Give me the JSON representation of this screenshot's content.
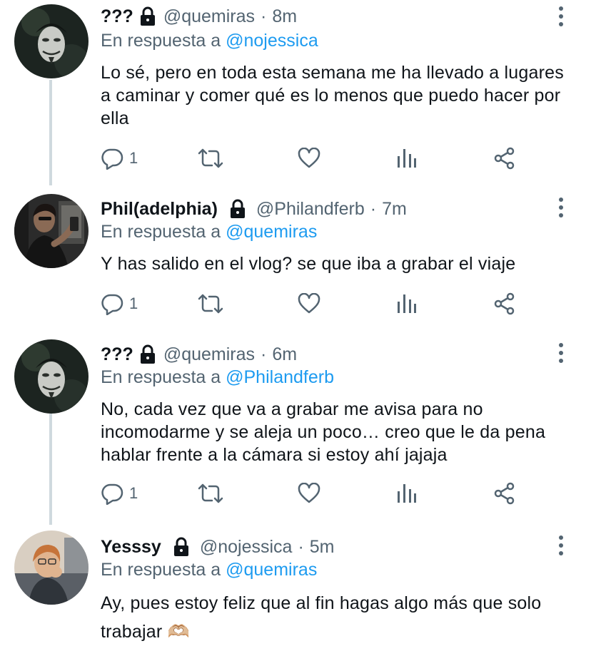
{
  "reply_prefix": "En respuesta a",
  "tweets": [
    {
      "name": "???",
      "handle": "@quemiras",
      "time": "8m",
      "reply_to": "@nojessica",
      "body": "Lo sé, pero en toda esta semana me ha llevado a lugares a caminar y comer qué es lo menos que puedo hacer por ella",
      "reply_count": "1"
    },
    {
      "name": "Phil(adelphia)",
      "handle": "@Philandferb",
      "time": "7m",
      "reply_to": "@quemiras",
      "body": "Y has salido en el vlog? se que iba a grabar el viaje",
      "reply_count": "1"
    },
    {
      "name": "???",
      "handle": "@quemiras",
      "time": "6m",
      "reply_to": "@Philandferb",
      "body": "No, cada vez que va a grabar me avisa para no incomodarme y se aleja un poco… creo que le da pena hablar frente a la cámara si estoy ahí jajaja",
      "reply_count": "1"
    },
    {
      "name": "Yesssy",
      "handle": "@nojessica",
      "time": "5m",
      "reply_to": "@quemiras",
      "body": "Ay, pues estoy feliz que al fin hagas algo más que solo trabajar 🫶🏼"
    }
  ],
  "separator": "·",
  "colors": {
    "text": "#0f1419",
    "secondary": "#536471",
    "link": "#1d9bf0",
    "thread_line": "#cfd9de"
  }
}
